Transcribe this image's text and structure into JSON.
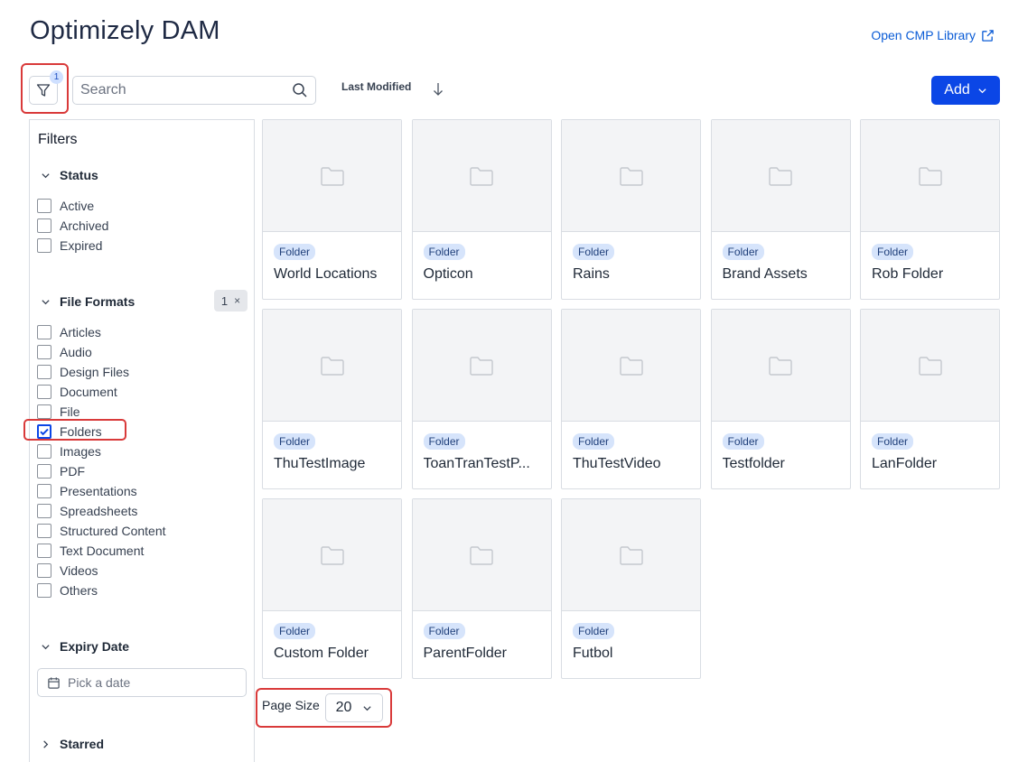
{
  "app": {
    "title": "Optimizely DAM",
    "open_cmp_label": "Open CMP Library"
  },
  "toolbar": {
    "filter_count": "1",
    "search_placeholder": "Search",
    "sort_label": "Last Modified",
    "add_label": "Add"
  },
  "sidebar": {
    "title": "Filters",
    "status": {
      "label": "Status",
      "options": [
        "Active",
        "Archived",
        "Expired"
      ]
    },
    "file_formats": {
      "label": "File Formats",
      "badge_count": "1",
      "badge_clear": "×",
      "options": [
        {
          "label": "Articles",
          "checked": false
        },
        {
          "label": "Audio",
          "checked": false
        },
        {
          "label": "Design Files",
          "checked": false
        },
        {
          "label": "Document",
          "checked": false
        },
        {
          "label": "File",
          "checked": false
        },
        {
          "label": "Folders",
          "checked": true
        },
        {
          "label": "Images",
          "checked": false
        },
        {
          "label": "PDF",
          "checked": false
        },
        {
          "label": "Presentations",
          "checked": false
        },
        {
          "label": "Spreadsheets",
          "checked": false
        },
        {
          "label": "Structured Content",
          "checked": false
        },
        {
          "label": "Text Document",
          "checked": false
        },
        {
          "label": "Videos",
          "checked": false
        },
        {
          "label": "Others",
          "checked": false
        }
      ]
    },
    "expiry_date": {
      "label": "Expiry Date",
      "placeholder": "Pick a date"
    },
    "starred": {
      "label": "Starred"
    }
  },
  "grid": {
    "items": [
      {
        "tag": "Folder",
        "name": "World Locations"
      },
      {
        "tag": "Folder",
        "name": "Opticon"
      },
      {
        "tag": "Folder",
        "name": "Rains"
      },
      {
        "tag": "Folder",
        "name": "Brand Assets"
      },
      {
        "tag": "Folder",
        "name": "Rob Folder"
      },
      {
        "tag": "Folder",
        "name": "ThuTestImage"
      },
      {
        "tag": "Folder",
        "name": "ToanTranTestP..."
      },
      {
        "tag": "Folder",
        "name": "ThuTestVideo"
      },
      {
        "tag": "Folder",
        "name": "Testfolder"
      },
      {
        "tag": "Folder",
        "name": "LanFolder"
      },
      {
        "tag": "Folder",
        "name": "Custom Folder"
      },
      {
        "tag": "Folder",
        "name": "ParentFolder"
      },
      {
        "tag": "Folder",
        "name": "Futbol"
      }
    ]
  },
  "pagination": {
    "page_size_label": "Page Size",
    "page_size_value": "20"
  },
  "colors": {
    "accent": "#0b46e6",
    "highlight": "#d93a3a",
    "tag_bg": "#d6e4fb",
    "link": "#0b5cd6"
  }
}
